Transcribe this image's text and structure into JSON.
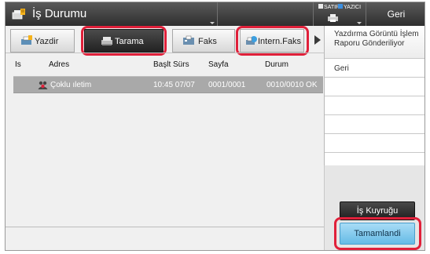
{
  "window": {
    "title": "İş Durumu",
    "back_label": "Geri"
  },
  "status_legend": {
    "line_label": "SATIR",
    "printer_label": "YAZICI",
    "line_color": "#e8e8e8",
    "printer_color": "#3c8fe0"
  },
  "tabs": [
    {
      "label": "Yazdir",
      "icon": "printer-icon",
      "active": false
    },
    {
      "label": "Tarama",
      "icon": "scanner-icon",
      "active": true
    },
    {
      "label": "Faks",
      "icon": "fax-icon",
      "active": false
    },
    {
      "label": "Intern.Faks",
      "icon": "internet-fax-icon",
      "active": false
    }
  ],
  "table": {
    "headers": [
      "Is",
      "Adres",
      "Başlt Sürs",
      "Sayfa",
      "Durum"
    ],
    "rows": [
      {
        "icon": "group-users-icon",
        "address": "Çoklu ıletim",
        "start": "10:45 07/07",
        "pages": "0001/0001",
        "status": "0010/0010 OK"
      }
    ]
  },
  "side_menu": {
    "items": [
      "Yazdırma Görüntü İşlem Raporu Gönderiliyor",
      "Geri"
    ]
  },
  "buttons": {
    "queue_label": "İş Kuyruğu",
    "done_label": "Tamamlandi"
  },
  "colors": {
    "highlight": "#e0203a",
    "done_button": "#7ec8ee"
  }
}
